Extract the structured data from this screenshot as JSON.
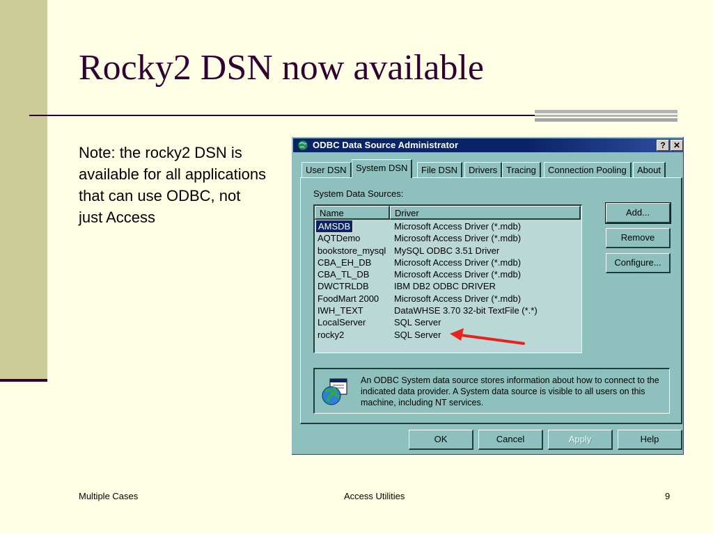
{
  "slide": {
    "title": "Rocky2 DSN now available",
    "body": "Note: the rocky2 DSN is available for all applications that can use ODBC, not just Access",
    "footer_left": "Multiple Cases",
    "footer_center": "Access Utilities",
    "footer_right": "9"
  },
  "dialog": {
    "title": "ODBC Data Source Administrator",
    "help_glyph": "?",
    "close_glyph": "✕",
    "tabs": [
      {
        "label": "User DSN"
      },
      {
        "label": "System DSN"
      },
      {
        "label": "File DSN"
      },
      {
        "label": "Drivers"
      },
      {
        "label": "Tracing"
      },
      {
        "label": "Connection Pooling"
      },
      {
        "label": "About"
      }
    ],
    "active_tab": "System DSN",
    "group_label": "System Data Sources:",
    "columns": {
      "name": "Name",
      "driver": "Driver"
    },
    "rows": [
      {
        "name": "AMSDB",
        "driver": "Microsoft Access Driver (*.mdb)"
      },
      {
        "name": "AQTDemo",
        "driver": "Microsoft Access Driver (*.mdb)"
      },
      {
        "name": "bookstore_mysql",
        "driver": "MySQL ODBC 3.51 Driver"
      },
      {
        "name": "CBA_EH_DB",
        "driver": "Microsoft Access Driver (*.mdb)"
      },
      {
        "name": "CBA_TL_DB",
        "driver": "Microsoft Access Driver (*.mdb)"
      },
      {
        "name": "DWCTRLDB",
        "driver": "IBM DB2 ODBC DRIVER"
      },
      {
        "name": "FoodMart 2000",
        "driver": "Microsoft Access Driver (*.mdb)"
      },
      {
        "name": "IWH_TEXT",
        "driver": "DataWHSE 3.70 32-bit TextFile (*.*)"
      },
      {
        "name": "LocalServer",
        "driver": "SQL Server"
      },
      {
        "name": "rocky2",
        "driver": "SQL Server"
      }
    ],
    "selected_row": "AMSDB",
    "side_buttons": {
      "add": "Add...",
      "remove": "Remove",
      "configure": "Configure..."
    },
    "info_text": "An ODBC System data source stores information about how to connect to the indicated data provider.   A System data source is visible to all users on this machine, including NT services.",
    "bottom_buttons": {
      "ok": "OK",
      "cancel": "Cancel",
      "apply": "Apply",
      "help": "Help"
    },
    "apply_disabled": true,
    "icons": {
      "app": "odbc-app-icon",
      "info": "globe-datasource-icon",
      "annotation": "red-arrow-pointer"
    },
    "colors": {
      "dialog_face": "#8EC1BD",
      "title_bar": "#0A246A",
      "selection": "#0A246A",
      "annotation_arrow": "#E8231E",
      "slide_bg": "#FFFFE5",
      "slide_accent": "#CCCC99",
      "title_text": "#330033"
    }
  }
}
